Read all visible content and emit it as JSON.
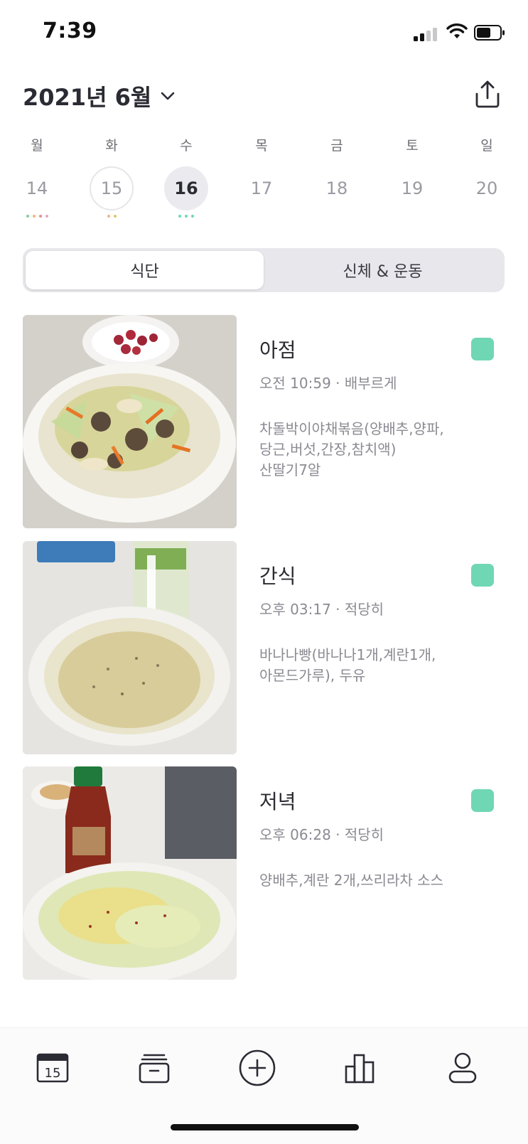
{
  "status": {
    "time": "7:39"
  },
  "header": {
    "month_label": "2021년 6월"
  },
  "week": {
    "days": [
      {
        "weekday": "월",
        "date": "14",
        "dots": [
          "#7fcf9f",
          "#f2b680",
          "#f08a8a",
          "#e9a3c9"
        ]
      },
      {
        "weekday": "화",
        "date": "15",
        "dots": [
          "#f2b680",
          "#e0c66a"
        ]
      },
      {
        "weekday": "수",
        "date": "16",
        "dots": [
          "#6fd7b3",
          "#6fd7b3",
          "#6fd7b3"
        ]
      },
      {
        "weekday": "목",
        "date": "17",
        "dots": []
      },
      {
        "weekday": "금",
        "date": "18",
        "dots": []
      },
      {
        "weekday": "토",
        "date": "19",
        "dots": []
      },
      {
        "weekday": "일",
        "date": "20",
        "dots": []
      }
    ]
  },
  "tabs": {
    "diet": "식단",
    "body": "신체 & 운동"
  },
  "meals": [
    {
      "title": "아점",
      "meta": "오전 10:59 · 배부르게",
      "desc": "차돌박이야채볶음(양배추,양파,\n당근,버섯,간장,참치액)\n산딸기7알",
      "tag_color": "#6fd7b3"
    },
    {
      "title": "간식",
      "meta": "오후 03:17 · 적당히",
      "desc": "바나나빵(바나나1개,계란1개,\n아몬드가루), 두유",
      "tag_color": "#6fd7b3"
    },
    {
      "title": "저녁",
      "meta": "오후 06:28 · 적당히",
      "desc": "양배추,계란 2개,쓰리라차 소스",
      "tag_color": "#6fd7b3"
    }
  ],
  "tabbar": {
    "calendar_day": "15"
  },
  "colors": {
    "accent": "#6fd7b3",
    "text": "#2b2b33",
    "muted": "#8a8a92"
  }
}
